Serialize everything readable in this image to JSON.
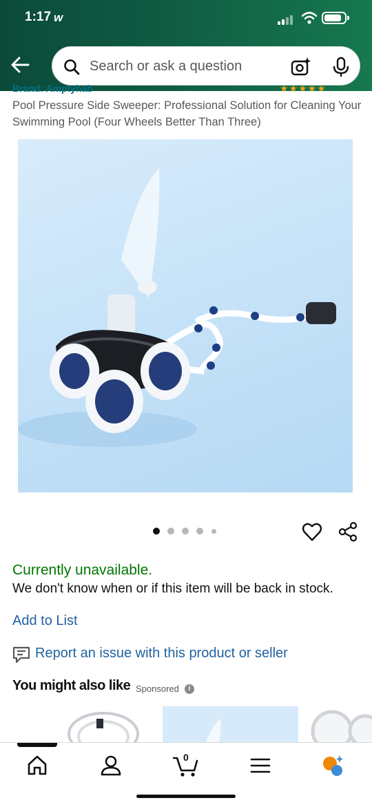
{
  "status_bar": {
    "time": "1:17",
    "carrier_logo": "w"
  },
  "search": {
    "placeholder": "Search or ask a question"
  },
  "product": {
    "brand": "Brand: Amptyhab",
    "title": "Pool Pressure Side Sweeper: Professional Solution for Cleaning Your Swimming Pool (Four Wheels Better Than Three)",
    "image_count": 5,
    "active_image_index": 0
  },
  "availability": {
    "status": "Currently unavailable.",
    "note": "We don't know when or if this item will be back in stock."
  },
  "actions": {
    "add_to_list": "Add to List",
    "report": "Report an issue with this product or seller"
  },
  "recommendations": {
    "title": "You might also like",
    "sponsored": "Sponsored",
    "info": "i"
  },
  "bottom_nav": {
    "cart_count": "0",
    "items": [
      "home-icon",
      "account-icon",
      "cart-icon",
      "menu-icon",
      "rufus-icon"
    ]
  },
  "colors": {
    "header_start": "#0b4a3a",
    "header_end": "#17784f",
    "link": "#2162a1",
    "available_green": "#007600",
    "brand_text": "#007185"
  }
}
